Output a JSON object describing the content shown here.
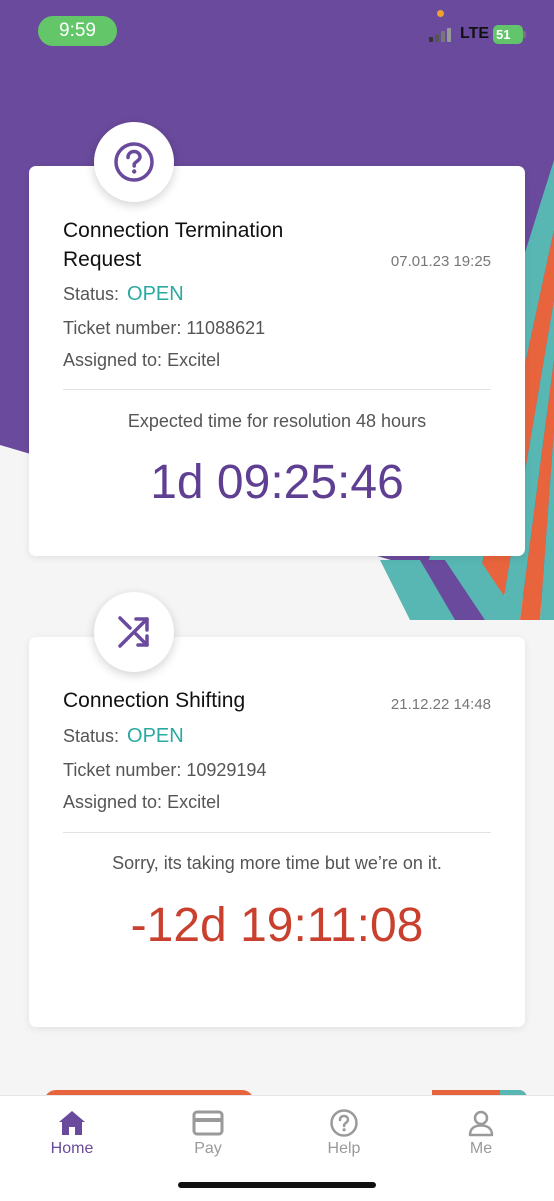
{
  "status_bar": {
    "time": "9:59",
    "network": "LTE",
    "battery": "51"
  },
  "tickets": [
    {
      "icon": "question-circle-icon",
      "title_line1": "Connection Termination",
      "title_line2": "Request",
      "date": "07.01.23 19:25",
      "status_label": "Status:",
      "status_value": "OPEN",
      "ticket_number": "Ticket number: 11088621",
      "assigned_to": "Assigned to: Excitel",
      "note": "Expected time for resolution 48 hours",
      "timer": "1d 09:25:46"
    },
    {
      "icon": "shuffle-icon",
      "title_line1": "Connection Shifting",
      "date": "21.12.22 14:48",
      "status_label": "Status:",
      "status_value": "OPEN",
      "ticket_number": "Ticket number: 10929194",
      "assigned_to": "Assigned to: Excitel",
      "note": "Sorry, its taking more time but we’re on it.",
      "timer": "-12d 19:11:08"
    }
  ],
  "tabbar": {
    "items": [
      {
        "label": "Home",
        "icon": "home-icon",
        "active": true
      },
      {
        "label": "Pay",
        "icon": "card-icon",
        "active": false
      },
      {
        "label": "Help",
        "icon": "help-icon",
        "active": false
      },
      {
        "label": "Me",
        "icon": "person-icon",
        "active": false
      }
    ]
  },
  "colors": {
    "brand_purple": "#6a4a9c",
    "status_open": "#2aa9a1",
    "timer_ok": "#5e3f92",
    "timer_overdue": "#c9412e",
    "stripe_orange": "#e8643c",
    "stripe_teal": "#58b7b3"
  }
}
